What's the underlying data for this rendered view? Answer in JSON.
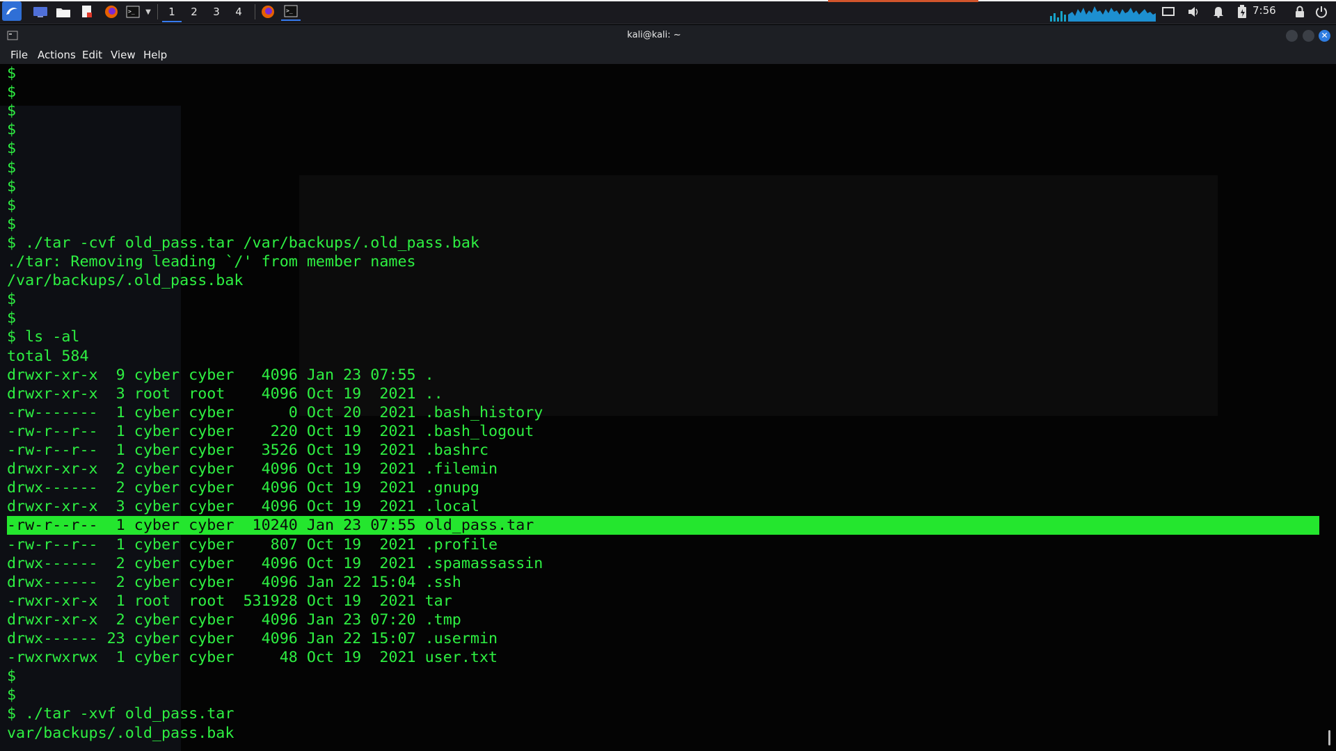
{
  "panel": {
    "workspaces": [
      "1",
      "2",
      "3",
      "4"
    ],
    "active_workspace": "1",
    "clock": "7:56",
    "icons": [
      "kali-menu-icon",
      "desktop-icon",
      "file-manager-icon",
      "text-editor-icon",
      "firefox-icon",
      "terminal-icon",
      "chevron-down-icon",
      "firefox-icon",
      "terminal-icon",
      "cpu-graph-icon",
      "display-icon",
      "volume-icon",
      "bell-icon",
      "battery-icon",
      "lock-icon",
      "power-icon"
    ]
  },
  "window": {
    "title": "kali@kali: ~"
  },
  "menu": {
    "file": "File",
    "actions": "Actions",
    "edit": "Edit",
    "view": "View",
    "help": "Help"
  },
  "terminal": {
    "lines": [
      "$",
      "$",
      "$",
      "$",
      "$",
      "$",
      "$",
      "$",
      "$",
      "$ ./tar -cvf old_pass.tar /var/backups/.old_pass.bak",
      "./tar: Removing leading `/' from member names",
      "/var/backups/.old_pass.bak",
      "$",
      "$",
      "$ ls -al",
      "total 584",
      "drwxr-xr-x  9 cyber cyber   4096 Jan 23 07:55 .",
      "drwxr-xr-x  3 root  root    4096 Oct 19  2021 ..",
      "-rw-------  1 cyber cyber      0 Oct 20  2021 .bash_history",
      "-rw-r--r--  1 cyber cyber    220 Oct 19  2021 .bash_logout",
      "-rw-r--r--  1 cyber cyber   3526 Oct 19  2021 .bashrc",
      "drwxr-xr-x  2 cyber cyber   4096 Oct 19  2021 .filemin",
      "drwx------  2 cyber cyber   4096 Oct 19  2021 .gnupg",
      "drwxr-xr-x  3 cyber cyber   4096 Oct 19  2021 .local",
      "-rw-r--r--  1 cyber cyber  10240 Jan 23 07:55 old_pass.tar",
      "-rw-r--r--  1 cyber cyber    807 Oct 19  2021 .profile",
      "drwx------  2 cyber cyber   4096 Oct 19  2021 .spamassassin",
      "drwx------  2 cyber cyber   4096 Jan 22 15:04 .ssh",
      "-rwxr-xr-x  1 root  root  531928 Oct 19  2021 tar",
      "drwxr-xr-x  2 cyber cyber   4096 Jan 23 07:20 .tmp",
      "drwx------ 23 cyber cyber   4096 Jan 22 15:07 .usermin",
      "-rwxrwxrwx  1 cyber cyber     48 Oct 19  2021 user.txt",
      "$",
      "$",
      "$ ./tar -xvf old_pass.tar",
      "var/backups/.old_pass.bak"
    ],
    "highlighted_line": 24,
    "colors": {
      "background": "#040404",
      "text": "#2ef042",
      "highlight_bg": "#24e62e",
      "highlight_text": "#0a0a0a"
    }
  }
}
